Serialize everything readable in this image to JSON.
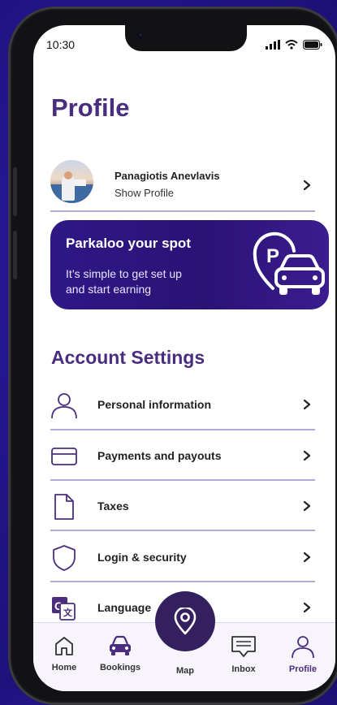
{
  "status_bar": {
    "time": "10:30"
  },
  "header": {
    "title": "Profile"
  },
  "profile": {
    "name": "Panagiotis Anevlavis",
    "link_label": "Show Profile"
  },
  "promo": {
    "title": "Parkaloo your spot",
    "text": "It’s simple to get set up and start earning"
  },
  "account_settings": {
    "heading": "Account Settings",
    "items": [
      {
        "label": "Personal information",
        "icon": "person-icon"
      },
      {
        "label": "Payments and payouts",
        "icon": "credit-card-icon"
      },
      {
        "label": "Taxes",
        "icon": "document-icon"
      },
      {
        "label": "Login & security",
        "icon": "shield-icon"
      },
      {
        "label": "Language",
        "icon": "translate-icon"
      }
    ]
  },
  "bottom_nav": {
    "items": [
      {
        "label": "Home",
        "icon": "home-icon"
      },
      {
        "label": "Bookings",
        "icon": "car-icon"
      },
      {
        "label": "Map",
        "icon": "location-pin-icon"
      },
      {
        "label": "Inbox",
        "icon": "message-icon"
      },
      {
        "label": "Profile",
        "icon": "person-icon",
        "active": true
      }
    ]
  },
  "colors": {
    "brand": "#4a2d7e",
    "promo": "#2a1275",
    "divider": "#b3a9d6",
    "background": "#221488"
  }
}
